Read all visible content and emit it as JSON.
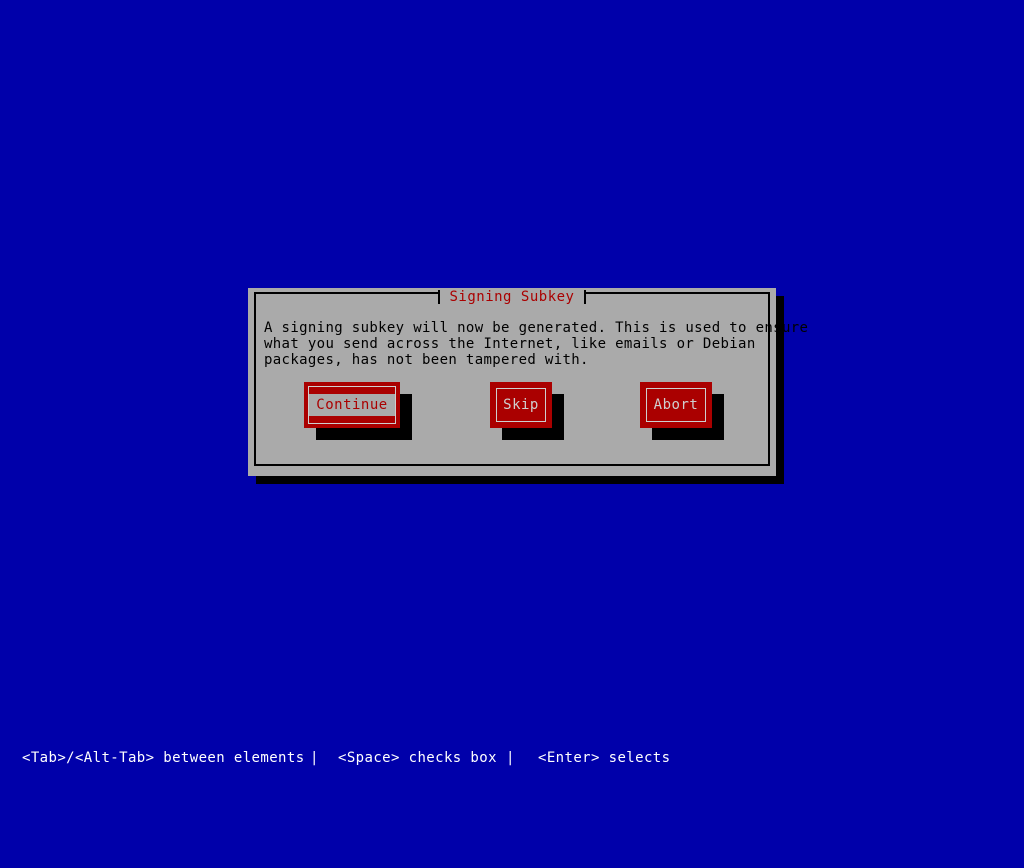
{
  "screen": {
    "background_color": "#0000aa",
    "panel_color": "#aaaaaa",
    "accent_color": "#aa0000",
    "shadow_color": "#000000",
    "label_color": "#cfcfcf"
  },
  "dialog": {
    "title": "Signing Subkey",
    "text": "A signing subkey will now be generated. This is used to ensure\nwhat you send across the Internet, like emails or Debian\npackages, has not been tampered with.",
    "buttons": [
      {
        "label": "Continue",
        "focused": true
      },
      {
        "label": "Skip",
        "focused": false
      },
      {
        "label": "Abort",
        "focused": false
      }
    ]
  },
  "status_bar": {
    "hints": [
      "<Tab>/<Alt-Tab> between elements",
      "<Space> checks box",
      "<Enter> selects"
    ],
    "separator": "|"
  }
}
